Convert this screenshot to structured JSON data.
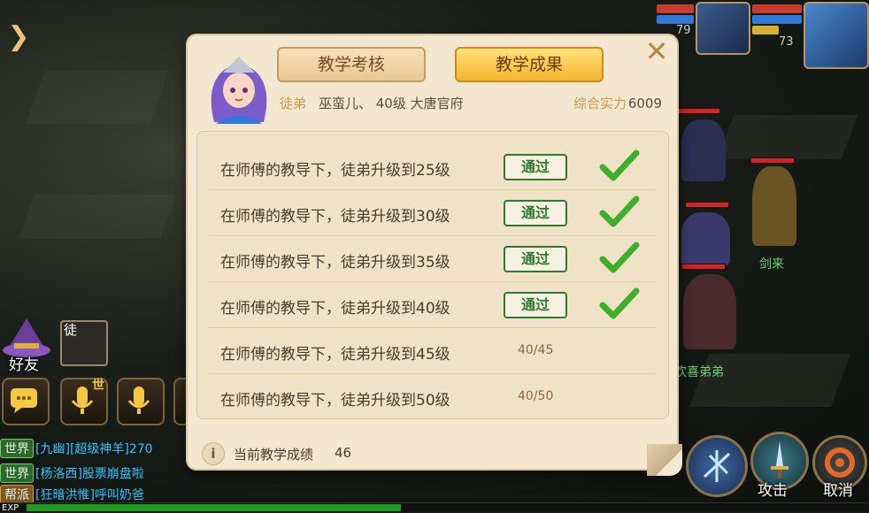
{
  "dialog": {
    "tabs": [
      {
        "label": "教学考核",
        "active": false
      },
      {
        "label": "教学成果",
        "active": true
      }
    ],
    "disciple_label": "徒弟",
    "disciple_info": "巫蛮儿、 40级 大唐官府",
    "power_label": "综合实力",
    "power_value": "6009",
    "tasks": [
      {
        "text": "在师傅的教导下，徒弟升级到25级",
        "status": "pass",
        "button": "通过"
      },
      {
        "text": "在师傅的教导下，徒弟升级到30级",
        "status": "pass",
        "button": "通过"
      },
      {
        "text": "在师傅的教导下，徒弟升级到35级",
        "status": "pass",
        "button": "通过"
      },
      {
        "text": "在师傅的教导下，徒弟升级到40级",
        "status": "pass",
        "button": "通过"
      },
      {
        "text": "在师傅的教导下，徒弟升级到45级",
        "status": "progress",
        "progress": "40/45"
      },
      {
        "text": "在师傅的教导下，徒弟升级到50级",
        "status": "progress",
        "progress": "40/50"
      }
    ],
    "score_label": "当前教学成绩",
    "score_value": "46"
  },
  "hud": {
    "pet_level": "79",
    "player_level": "73",
    "units": [
      "剑来",
      "欢喜弟弟"
    ]
  },
  "social": {
    "friends_label": "好友",
    "disciple_tag": "徒",
    "voice_world_tag": "世",
    "chat": [
      {
        "channel": "世界",
        "name": "[九幽]",
        "text": "[超级神羊]270"
      },
      {
        "channel": "世界",
        "name": "[杨洛西]",
        "text": "股票崩盘啦"
      },
      {
        "channel": "帮派",
        "name": "[狂暗洪惟]",
        "text": "呼叫奶爸"
      }
    ]
  },
  "actions": {
    "attack_label": "攻击",
    "cancel_label": "取消"
  },
  "exp": {
    "label": "EXP",
    "fill": 0.45
  },
  "colors": {
    "pass_green": "#2f7a2f",
    "check_green": "#3fae2b",
    "tab_active": "#f5b52e",
    "dialog_bg": "#f3e7cf"
  }
}
